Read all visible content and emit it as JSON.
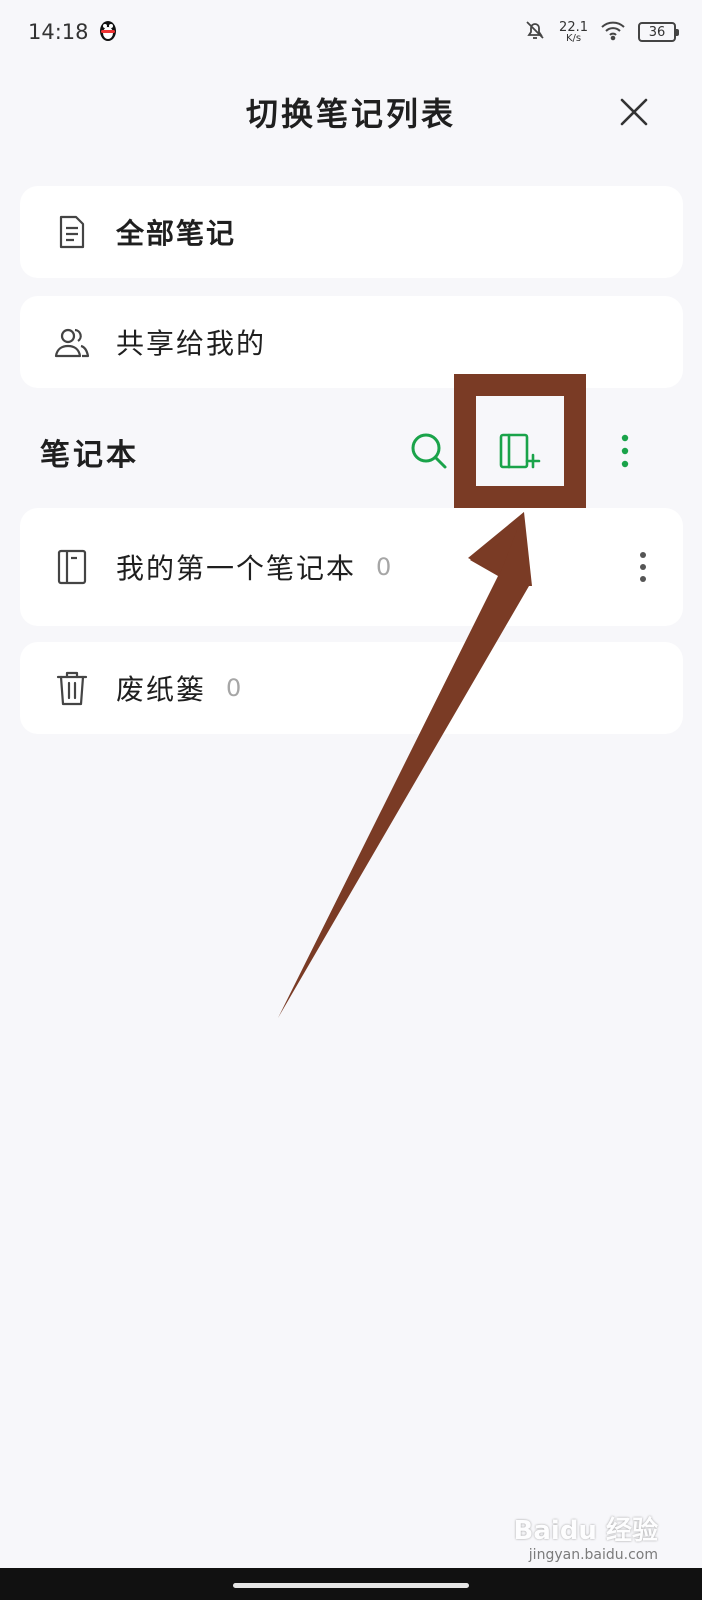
{
  "status_bar": {
    "time": "14:18",
    "notification_icon": "qq-penguin-icon",
    "net_speed_value": "22.1",
    "net_speed_unit": "K/s",
    "battery": "36"
  },
  "header": {
    "title": "切换笔记列表",
    "close_icon": "close-icon"
  },
  "top_items": [
    {
      "label": "全部笔记",
      "icon": "document-icon"
    },
    {
      "label": "共享给我的",
      "icon": "users-icon"
    }
  ],
  "notebook_section": {
    "title": "笔记本",
    "accent_color": "#1aa34a",
    "actions": [
      "search-icon",
      "new-notebook-icon",
      "more-vertical-icon"
    ]
  },
  "notebooks": [
    {
      "name": "我的第一个笔记本",
      "count": "0"
    },
    {
      "name": "废纸篓",
      "count": "0"
    }
  ],
  "annotation": {
    "highlight_color": "#7a3b25"
  },
  "watermark": {
    "brand": "Baidu 经验",
    "url": "jingyan.baidu.com"
  }
}
